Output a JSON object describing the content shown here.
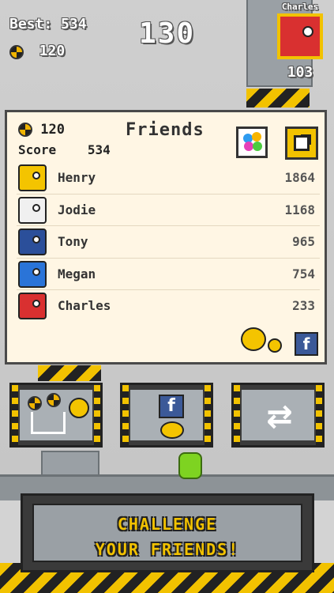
{
  "hud": {
    "best_label": "Best: 534",
    "coins": "120",
    "current_score": "130",
    "rival_name": "Charles",
    "rival_score": "103"
  },
  "panel": {
    "coins": "120",
    "title": "Friends",
    "score_label": "Score",
    "score_value": "534"
  },
  "friends": [
    {
      "name": "Henry",
      "score": "1864",
      "color": "#f4c400"
    },
    {
      "name": "Jodie",
      "score": "1168",
      "color": "#f0f0f0"
    },
    {
      "name": "Tony",
      "score": "965",
      "color": "#2b4f9a"
    },
    {
      "name": "Megan",
      "score": "754",
      "color": "#2a74d8"
    },
    {
      "name": "Charles",
      "score": "233",
      "color": "#d93030"
    }
  ],
  "buttons": {
    "shop_icon": "cart-coins-icon",
    "facebook_icon": "facebook-icon",
    "refresh_icon": "refresh-arrows-icon",
    "facebook_letter": "f"
  },
  "banner": {
    "line1": "CHALLENGE",
    "line2": "YOUR FRIENDS!"
  },
  "colors": {
    "accent_yellow": "#f2c200",
    "panel_bg": "#fff6e4",
    "facebook_blue": "#3b5998",
    "rival_red": "#d93030"
  }
}
